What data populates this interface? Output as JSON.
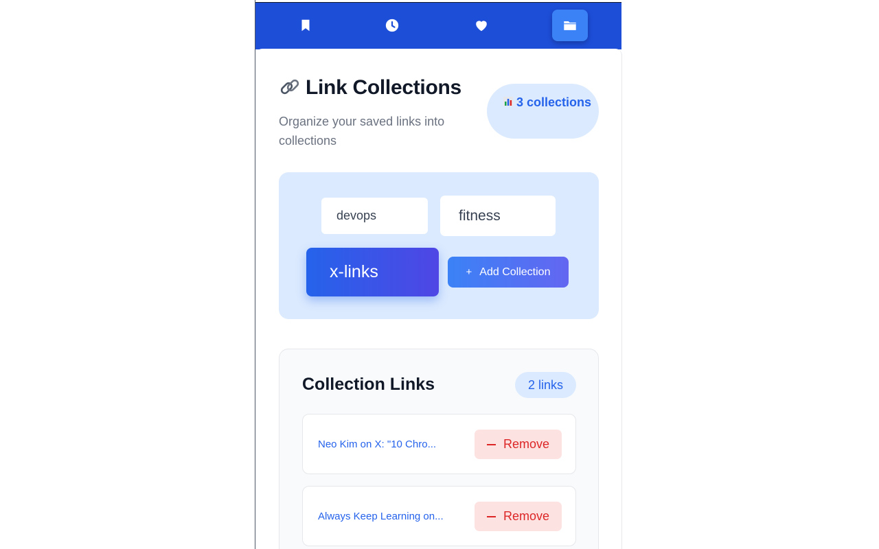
{
  "nav": {
    "items": [
      {
        "icon": "bookmark-icon",
        "active": false
      },
      {
        "icon": "clock-icon",
        "active": false
      },
      {
        "icon": "heart-icon",
        "active": false
      },
      {
        "icon": "folder-icon",
        "active": true
      }
    ]
  },
  "header": {
    "title_icon": "link-icon",
    "title": "Link Collections",
    "subtitle": "Organize your saved links into collections",
    "count_icon": "bar-chart-icon",
    "count_label": "3 collections"
  },
  "collections": {
    "items": [
      {
        "name": "devops",
        "active": false
      },
      {
        "name": "fitness",
        "active": false
      },
      {
        "name": "x-links",
        "active": true
      }
    ],
    "add_label": "Add Collection",
    "add_icon": "+"
  },
  "links_panel": {
    "title": "Collection Links",
    "count_label": "2 links",
    "links": [
      {
        "title": "Neo Kim on X: \"10 Chro...",
        "remove_label": "Remove"
      },
      {
        "title": "Always Keep Learning on...",
        "remove_label": "Remove"
      }
    ]
  },
  "colors": {
    "nav_bg": "#1d4ed8",
    "accent": "#2563eb",
    "danger": "#dc2626",
    "chip_area_bg": "#dbeafe"
  }
}
